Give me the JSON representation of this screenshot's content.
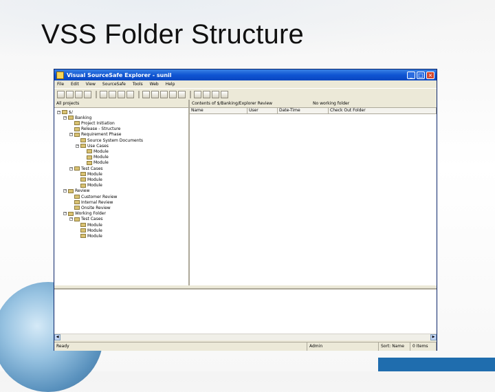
{
  "slide": {
    "title": "VSS Folder Structure"
  },
  "window": {
    "title": "Visual SourceSafe Explorer - sunil",
    "buttons": {
      "minimize": "_",
      "maximize": "□",
      "close": "×"
    }
  },
  "menu": [
    "File",
    "Edit",
    "View",
    "SourceSafe",
    "Tools",
    "Web",
    "Help"
  ],
  "left_pane": {
    "header": "All projects",
    "tree": [
      {
        "label": "$/",
        "depth": 0,
        "expander": "−"
      },
      {
        "label": "Banking",
        "depth": 1,
        "expander": "−"
      },
      {
        "label": "Project Initiation",
        "depth": 2,
        "expander": ""
      },
      {
        "label": "Release - Structure",
        "depth": 2,
        "expander": ""
      },
      {
        "label": "Requirement Phase",
        "depth": 2,
        "expander": "−"
      },
      {
        "label": "Source System Documents",
        "depth": 3,
        "expander": ""
      },
      {
        "label": "Use Cases",
        "depth": 3,
        "expander": "−"
      },
      {
        "label": "Module",
        "depth": 4,
        "expander": ""
      },
      {
        "label": "Module",
        "depth": 4,
        "expander": ""
      },
      {
        "label": "Module",
        "depth": 4,
        "expander": ""
      },
      {
        "label": "Test Cases",
        "depth": 2,
        "expander": "−"
      },
      {
        "label": "Module",
        "depth": 3,
        "expander": ""
      },
      {
        "label": "Module",
        "depth": 3,
        "expander": ""
      },
      {
        "label": "Module",
        "depth": 3,
        "expander": ""
      },
      {
        "label": "Review",
        "depth": 1,
        "expander": "−"
      },
      {
        "label": "Customer Review",
        "depth": 2,
        "expander": ""
      },
      {
        "label": "Internal Review",
        "depth": 2,
        "expander": ""
      },
      {
        "label": "Onsite Review",
        "depth": 2,
        "expander": ""
      },
      {
        "label": "Working Folder",
        "depth": 1,
        "expander": "−"
      },
      {
        "label": "Test Cases",
        "depth": 2,
        "expander": "−"
      },
      {
        "label": "Module",
        "depth": 3,
        "expander": ""
      },
      {
        "label": "Module",
        "depth": 3,
        "expander": ""
      },
      {
        "label": "Module",
        "depth": 3,
        "expander": ""
      }
    ]
  },
  "right_pane": {
    "path": "Contents of $/Banking/Explorer Review",
    "working_folder": "No working folder",
    "columns": [
      "Name",
      "User",
      "Date-Time",
      "Check Out Folder"
    ]
  },
  "status_bar": {
    "left": "Ready",
    "user": "Admin",
    "sort": "Sort: Name",
    "items": "0 Items"
  },
  "colors": {
    "titlebar": "#0a46c0",
    "window_bg": "#ece9d8",
    "accent_bar": "#1f6dae"
  }
}
